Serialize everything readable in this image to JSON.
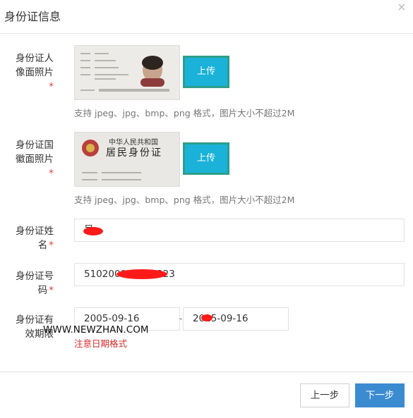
{
  "dialog": {
    "title": "身份证信息",
    "close_icon": "close-icon"
  },
  "form": {
    "front_photo": {
      "label_line1": "身份证人",
      "label_line2": "像面照片",
      "upload_label": "上传",
      "hint": "支持 jpeg、jpg、bmp、png 格式，图片大小不超过2M"
    },
    "back_photo": {
      "label_line1": "身份证国",
      "label_line2": "徽面照片",
      "upload_label": "上传",
      "hint": "支持 jpeg、jpg、bmp、png 格式，图片大小不超过2M",
      "card_title": "中华人民共和国",
      "card_subtitle": "居民身份证"
    },
    "name": {
      "label_line1": "身份证姓",
      "label_line2": "名",
      "value": "吴"
    },
    "id_number": {
      "label_line1": "身份证号",
      "label_line2": "码",
      "value": "510200000008223"
    },
    "validity": {
      "label_line1": "身份证有",
      "label_line2": "效期限",
      "start": "2005-09-16",
      "separator": "-",
      "end": "2015-09-16",
      "warning": "注意日期格式"
    },
    "required_mark": "*"
  },
  "watermark": "WWW.NEWZHAN.COM",
  "footer": {
    "prev_label": "上一步",
    "next_label": "下一步"
  },
  "colors": {
    "upload_button": "#1ab2d8",
    "primary": "#3b8bd1",
    "required": "#e4393c",
    "warning": "#d62b2b"
  }
}
